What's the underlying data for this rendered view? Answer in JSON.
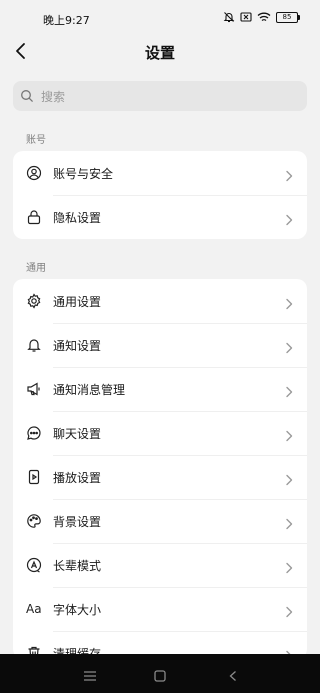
{
  "status_bar": {
    "time": "晚上9:27",
    "battery": "85",
    "icons": [
      "mute-bell-icon",
      "sim-x-icon",
      "wifi-icon",
      "battery-icon"
    ]
  },
  "header": {
    "title": "设置"
  },
  "search": {
    "placeholder": "搜索"
  },
  "sections": [
    {
      "header": "账号",
      "items": [
        {
          "label": "账号与安全",
          "icon": "user-circle-icon"
        },
        {
          "label": "隐私设置",
          "icon": "lock-icon"
        }
      ]
    },
    {
      "header": "通用",
      "items": [
        {
          "label": "通用设置",
          "icon": "gear-icon"
        },
        {
          "label": "通知设置",
          "icon": "bell-icon"
        },
        {
          "label": "通知消息管理",
          "icon": "megaphone-icon"
        },
        {
          "label": "聊天设置",
          "icon": "chat-bubble-icon"
        },
        {
          "label": "播放设置",
          "icon": "play-device-icon"
        },
        {
          "label": "背景设置",
          "icon": "palette-icon"
        },
        {
          "label": "长辈模式",
          "icon": "elder-mode-icon"
        },
        {
          "label": "字体大小",
          "icon": "font-size-icon",
          "icon_text": "Aa"
        },
        {
          "label": "清理缓存",
          "icon": "trash-icon"
        }
      ]
    }
  ],
  "system_nav": [
    "menu-icon",
    "home-square-icon",
    "back-triangle-icon"
  ]
}
